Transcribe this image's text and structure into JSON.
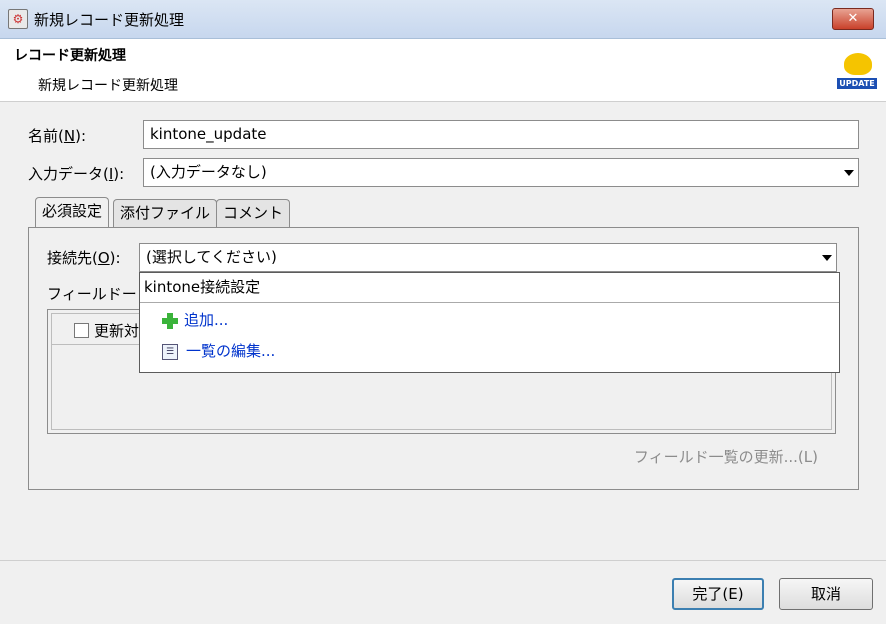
{
  "window": {
    "title": "新規レコード更新処理"
  },
  "header": {
    "title": "レコード更新処理",
    "subtitle": "新規レコード更新処理",
    "icon_label": "UPDATE"
  },
  "form": {
    "name_label": "名前(N):",
    "name_value": "kintone_update",
    "input_label": "入力データ(I):",
    "input_value": "(入力データなし)"
  },
  "tabs": [
    "必須設定",
    "添付ファイル",
    "コメント"
  ],
  "required": {
    "connection_label": "接続先(O):",
    "connection_value": "(選択してください)",
    "field_label": "フィールドー",
    "column_header": "更新対",
    "refresh_button": "フィールド一覧の更新...(L)"
  },
  "dropdown": {
    "items": [
      "kintone接続設定"
    ],
    "actions": [
      "追加...",
      "一覧の編集..."
    ]
  },
  "buttons": {
    "ok": "完了(E)",
    "cancel": "取消"
  }
}
